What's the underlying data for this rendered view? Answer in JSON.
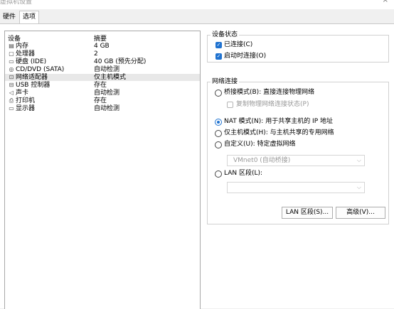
{
  "window": {
    "title": "虚拟机设置",
    "close_glyph": "×"
  },
  "tabs": [
    {
      "label": "硬件"
    },
    {
      "label": "选项"
    }
  ],
  "device_list": {
    "col_device": "设备",
    "col_summary": "摘要",
    "rows": [
      {
        "icon": "memory-icon",
        "glyph": "▤",
        "name": "内存",
        "summary": "4 GB",
        "selected": false
      },
      {
        "icon": "processor-icon",
        "glyph": "▢",
        "name": "处理器",
        "summary": "2",
        "selected": false
      },
      {
        "icon": "hard-disk-icon",
        "glyph": "▭",
        "name": "硬盘 (IDE)",
        "summary": "40 GB (预先分配)",
        "selected": false
      },
      {
        "icon": "cd-dvd-icon",
        "glyph": "◎",
        "name": "CD/DVD (SATA)",
        "summary": "自动检测",
        "selected": false
      },
      {
        "icon": "network-adapter-icon",
        "glyph": "⊡",
        "name": "网络适配器",
        "summary": "仅主机模式",
        "selected": true
      },
      {
        "icon": "usb-icon",
        "glyph": "⊟",
        "name": "USB 控制器",
        "summary": "存在",
        "selected": false
      },
      {
        "icon": "sound-card-icon",
        "glyph": "◁",
        "name": "声卡",
        "summary": "自动检测",
        "selected": false
      },
      {
        "icon": "printer-icon",
        "glyph": "⎙",
        "name": "打印机",
        "summary": "存在",
        "selected": false
      },
      {
        "icon": "display-icon",
        "glyph": "▭",
        "name": "显示器",
        "summary": "自动检测",
        "selected": false
      }
    ]
  },
  "device_status": {
    "title": "设备状态",
    "connected": {
      "label": "已连接(C)",
      "checked": true
    },
    "connect_on_power": {
      "label": "启动时连接(O)",
      "checked": true
    }
  },
  "network": {
    "title": "网络连接",
    "bridged": {
      "label": "桥接模式(B): 直接连接物理网络",
      "selected": false
    },
    "replicate": {
      "label": "复制物理网络连接状态(P)",
      "checked": false
    },
    "nat": {
      "label": "NAT 模式(N): 用于共享主机的 IP 地址",
      "selected": true
    },
    "host_only": {
      "label": "仅主机模式(H): 与主机共享的专用网络",
      "selected": false
    },
    "custom": {
      "label": "自定义(U): 特定虚拟网络",
      "selected": false
    },
    "custom_select": {
      "value": "VMnet0 (自动桥接)"
    },
    "lan": {
      "label": "LAN 区段(L):",
      "selected": false
    },
    "lan_select": {
      "value": ""
    }
  },
  "buttons": {
    "lan_segments": "LAN 区段(S)...",
    "advanced": "高级(V)..."
  }
}
